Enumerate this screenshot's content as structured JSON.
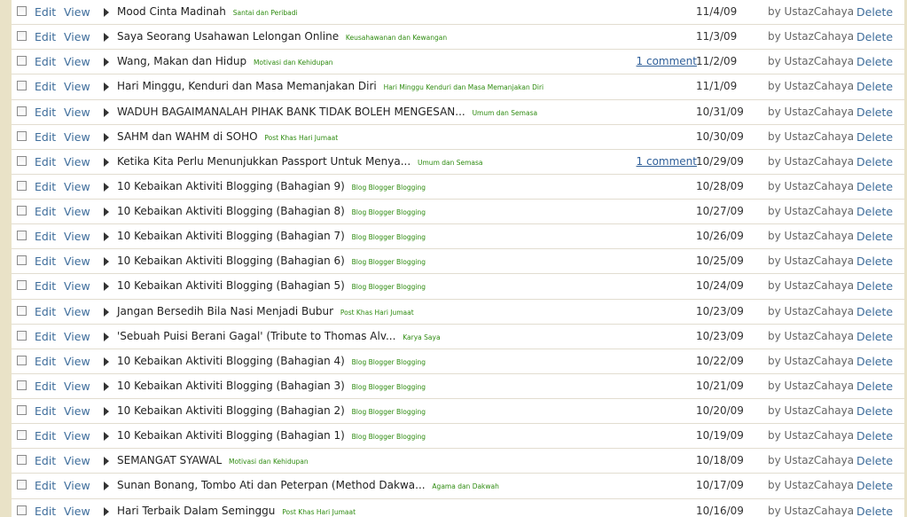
{
  "actions": {
    "edit": "Edit",
    "view": "View",
    "delete": "Delete"
  },
  "posts": [
    {
      "title": "Mood Cinta Madinah",
      "labels": "Santai dan Peribadi",
      "comment": "",
      "date": "11/4/09",
      "author": "by UstazCahaya"
    },
    {
      "title": "Saya Seorang Usahawan Lelongan Online",
      "labels": "Keusahawanan dan Kewangan",
      "comment": "",
      "date": "11/3/09",
      "author": "by UstazCahaya"
    },
    {
      "title": "Wang, Makan dan Hidup",
      "labels": "Motivasi dan Kehidupan",
      "comment": "1 comment",
      "date": "11/2/09",
      "author": "by UstazCahaya"
    },
    {
      "title": "Hari Minggu, Kenduri dan Masa Memanjakan Diri",
      "labels": "Hari Minggu Kenduri dan Masa Memanjakan Diri",
      "comment": "",
      "date": "11/1/09",
      "author": "by UstazCahaya"
    },
    {
      "title": "WADUH BAGAIMANALAH PIHAK BANK TIDAK BOLEH MENGESAN...",
      "labels": "Umum dan Semasa",
      "comment": "",
      "date": "10/31/09",
      "author": "by UstazCahaya"
    },
    {
      "title": "SAHM dan WAHM di SOHO",
      "labels": "Post Khas Hari Jumaat",
      "comment": "",
      "date": "10/30/09",
      "author": "by UstazCahaya"
    },
    {
      "title": "Ketika Kita Perlu Menunjukkan Passport Untuk Menya...",
      "labels": "Umum dan Semasa",
      "comment": "1 comment",
      "date": "10/29/09",
      "author": "by UstazCahaya"
    },
    {
      "title": "10 Kebaikan Aktiviti Blogging (Bahagian 9)",
      "labels": "Blog Blogger Blogging",
      "comment": "",
      "date": "10/28/09",
      "author": "by UstazCahaya"
    },
    {
      "title": "10 Kebaikan Aktiviti Blogging (Bahagian 8)",
      "labels": "Blog Blogger Blogging",
      "comment": "",
      "date": "10/27/09",
      "author": "by UstazCahaya"
    },
    {
      "title": "10 Kebaikan Aktiviti Blogging (Bahagian 7)",
      "labels": "Blog Blogger Blogging",
      "comment": "",
      "date": "10/26/09",
      "author": "by UstazCahaya"
    },
    {
      "title": "10 Kebaikan Aktiviti Blogging (Bahagian 6)",
      "labels": "Blog Blogger Blogging",
      "comment": "",
      "date": "10/25/09",
      "author": "by UstazCahaya"
    },
    {
      "title": "10 Kebaikan Aktiviti Blogging (Bahagian 5)",
      "labels": "Blog Blogger Blogging",
      "comment": "",
      "date": "10/24/09",
      "author": "by UstazCahaya"
    },
    {
      "title": "Jangan Bersedih Bila Nasi Menjadi Bubur",
      "labels": "Post Khas Hari Jumaat",
      "comment": "",
      "date": "10/23/09",
      "author": "by UstazCahaya"
    },
    {
      "title": "'Sebuah Puisi Berani Gagal' (Tribute to Thomas Alv...",
      "labels": "Karya Saya",
      "comment": "",
      "date": "10/23/09",
      "author": "by UstazCahaya"
    },
    {
      "title": "10 Kebaikan Aktiviti Blogging (Bahagian 4)",
      "labels": "Blog Blogger Blogging",
      "comment": "",
      "date": "10/22/09",
      "author": "by UstazCahaya"
    },
    {
      "title": "10 Kebaikan Aktiviti Blogging (Bahagian 3)",
      "labels": "Blog Blogger Blogging",
      "comment": "",
      "date": "10/21/09",
      "author": "by UstazCahaya"
    },
    {
      "title": "10 Kebaikan Aktiviti Blogging (Bahagian 2)",
      "labels": "Blog Blogger Blogging",
      "comment": "",
      "date": "10/20/09",
      "author": "by UstazCahaya"
    },
    {
      "title": "10 Kebaikan Aktiviti Blogging (Bahagian 1)",
      "labels": "Blog Blogger Blogging",
      "comment": "",
      "date": "10/19/09",
      "author": "by UstazCahaya"
    },
    {
      "title": "SEMANGAT SYAWAL",
      "labels": "Motivasi dan Kehidupan",
      "comment": "",
      "date": "10/18/09",
      "author": "by UstazCahaya"
    },
    {
      "title": "Sunan Bonang, Tombo Ati dan Peterpan (Method Dakwa...",
      "labels": "Agama dan Dakwah",
      "comment": "",
      "date": "10/17/09",
      "author": "by UstazCahaya"
    },
    {
      "title": "Hari Terbaik Dalam Seminggu",
      "labels": "Post Khas Hari Jumaat",
      "comment": "",
      "date": "10/16/09",
      "author": "by UstazCahaya"
    }
  ]
}
